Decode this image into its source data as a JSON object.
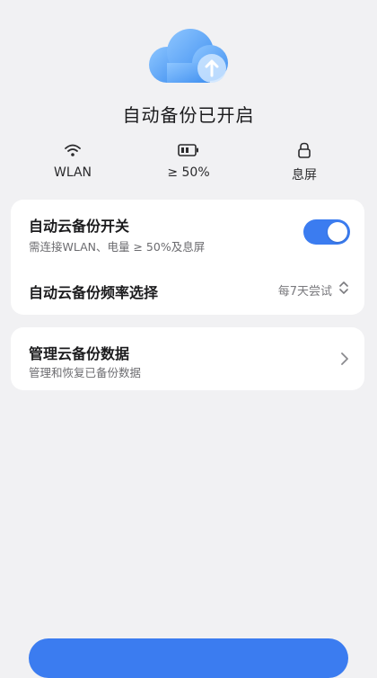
{
  "header": {
    "title": "自动备份已开启",
    "cloud_icon": "cloud-upload-icon"
  },
  "conditions": [
    {
      "icon": "wifi-icon",
      "label": "WLAN"
    },
    {
      "icon": "battery-icon",
      "label": "≥ 50%"
    },
    {
      "icon": "lock-icon",
      "label": "息屏"
    }
  ],
  "backup_settings": {
    "toggle_title": "自动云备份开关",
    "toggle_subtitle": "需连接WLAN、电量 ≥ 50%及息屏",
    "toggle_on": true,
    "frequency_title": "自动云备份频率选择",
    "frequency_value": "每7天尝试"
  },
  "manage": {
    "title": "管理云备份数据",
    "subtitle": "管理和恢复已备份数据"
  },
  "colors": {
    "accent": "#3b7cf0",
    "background": "#f1f1f3",
    "card": "#ffffff"
  }
}
